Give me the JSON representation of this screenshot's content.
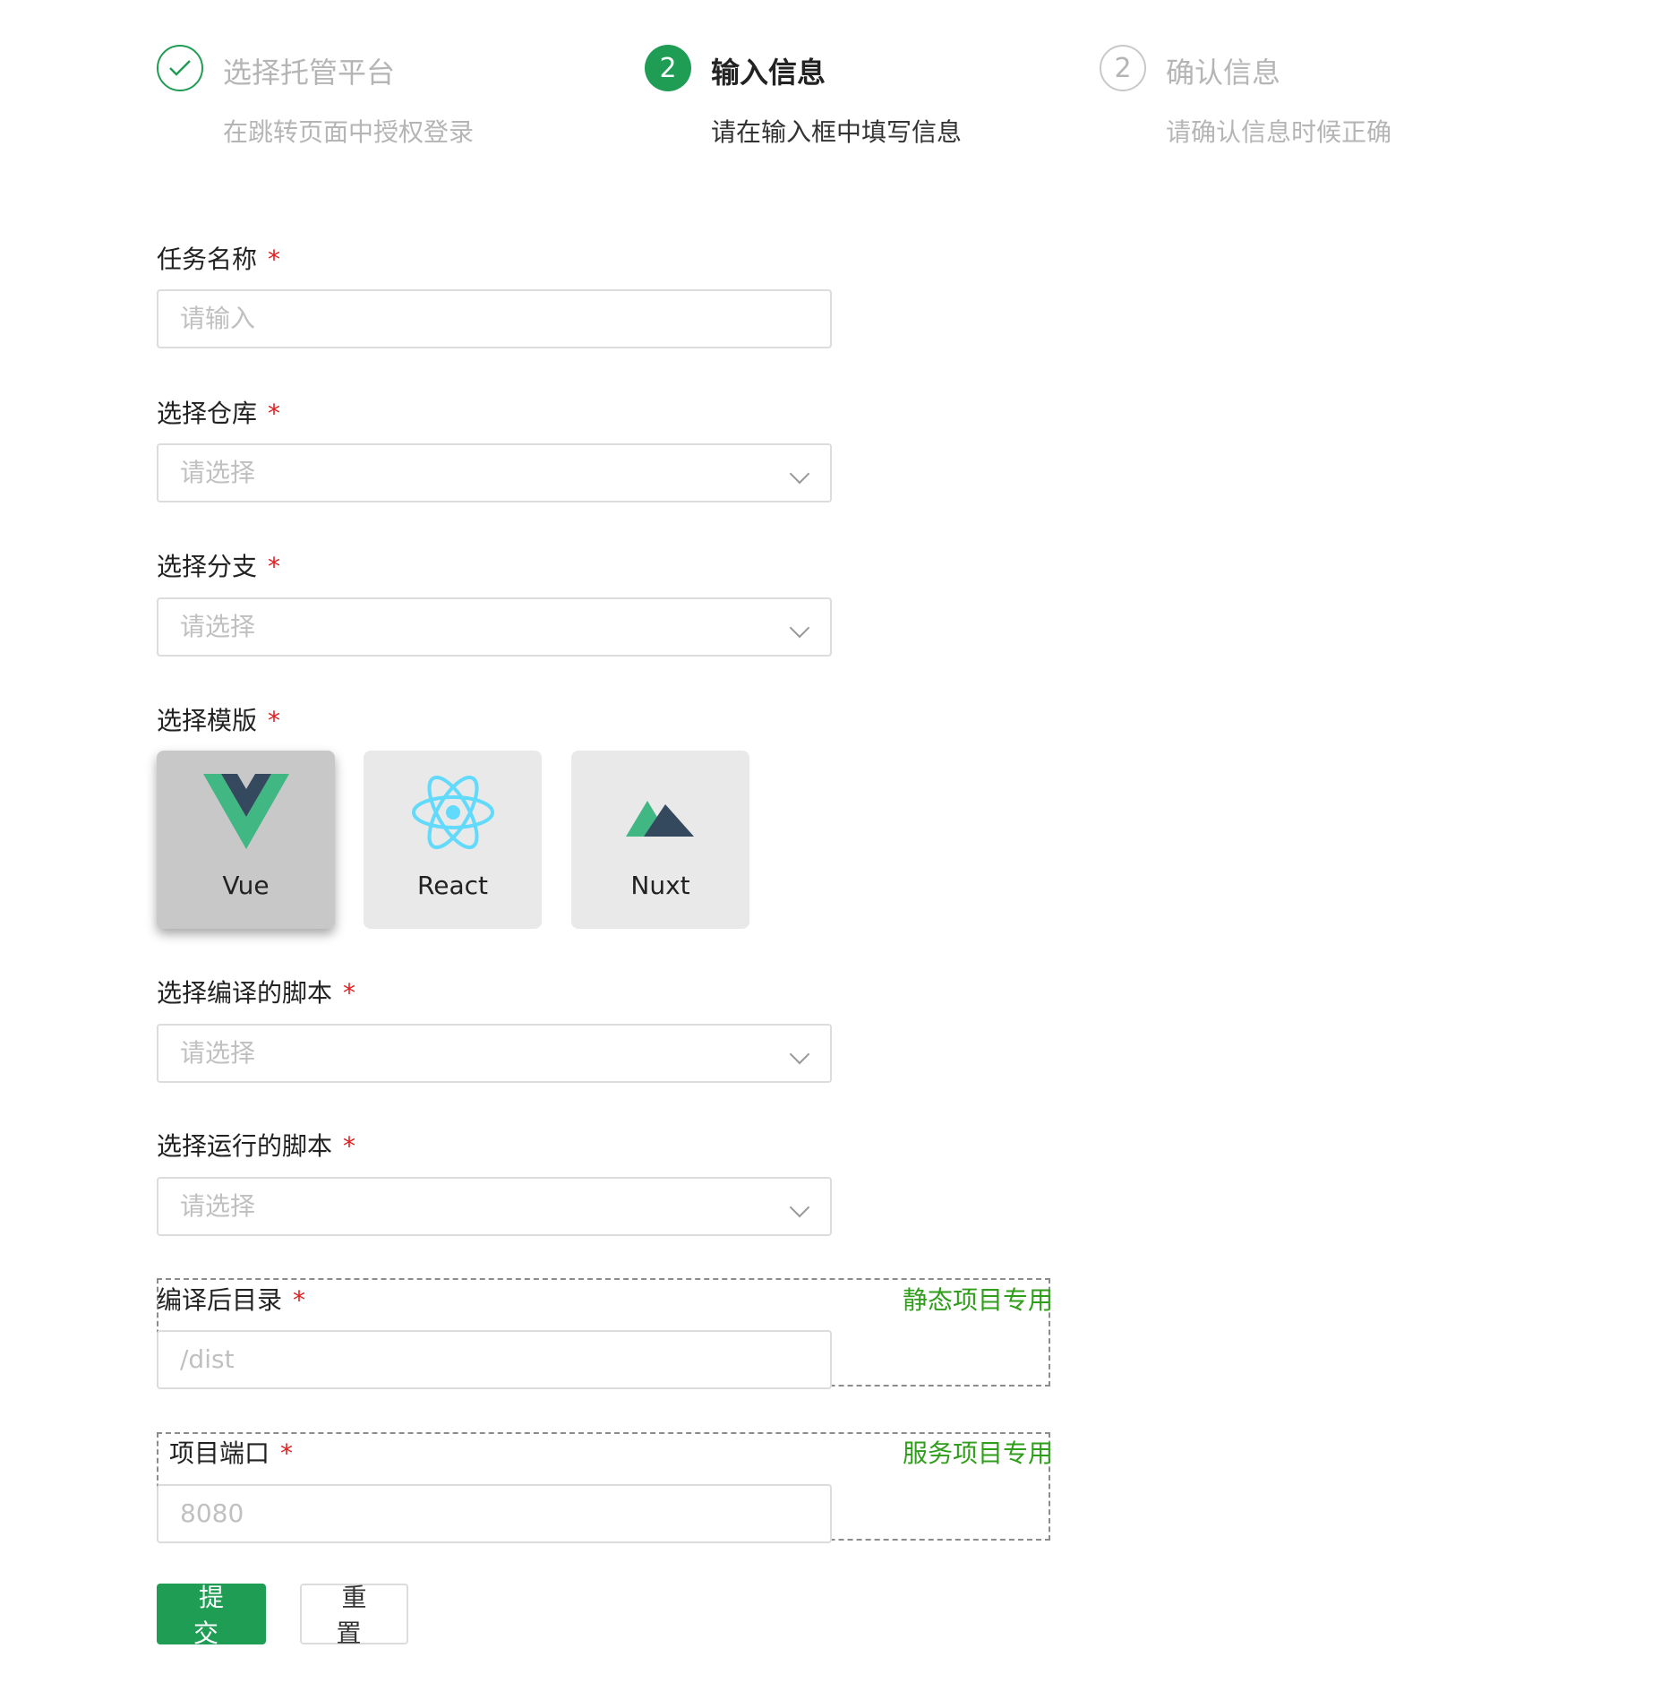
{
  "steps": [
    {
      "number": "✓",
      "title": "选择托管平台",
      "desc": "在跳转页面中授权登录",
      "state": "done"
    },
    {
      "number": "2",
      "title": "输入信息",
      "desc": "请在输入框中填写信息",
      "state": "active"
    },
    {
      "number": "2",
      "title": "确认信息",
      "desc": "请确认信息时候正确",
      "state": "wait"
    }
  ],
  "required_mark": "*",
  "form": {
    "task_name": {
      "label": "任务名称",
      "placeholder": "请输入"
    },
    "repo": {
      "label": "选择仓库",
      "placeholder": "请选择"
    },
    "branch": {
      "label": "选择分支",
      "placeholder": "请选择"
    },
    "template": {
      "label": "选择模版",
      "options": [
        {
          "name": "Vue",
          "icon": "vue-logo-icon",
          "selected": true
        },
        {
          "name": "React",
          "icon": "react-logo-icon",
          "selected": false
        },
        {
          "name": "Nuxt",
          "icon": "nuxt-logo-icon",
          "selected": false
        }
      ]
    },
    "build_script": {
      "label": "选择编译的脚本",
      "placeholder": "请选择"
    },
    "run_script": {
      "label": "选择运行的脚本",
      "placeholder": "请选择"
    },
    "output_dir": {
      "label": "编译后目录",
      "placeholder": "/dist",
      "tag": "静态项目专用"
    },
    "port": {
      "label": "项目端口",
      "placeholder": "8080",
      "tag": "服务项目专用"
    }
  },
  "buttons": {
    "submit": "提 交",
    "reset": "重 置"
  },
  "colors": {
    "primary": "#1f9d55",
    "required": "#e02020",
    "tag": "#2f9e1a",
    "vue_green": "#41b883",
    "vue_dark": "#35495e",
    "react_blue": "#61dafb"
  }
}
